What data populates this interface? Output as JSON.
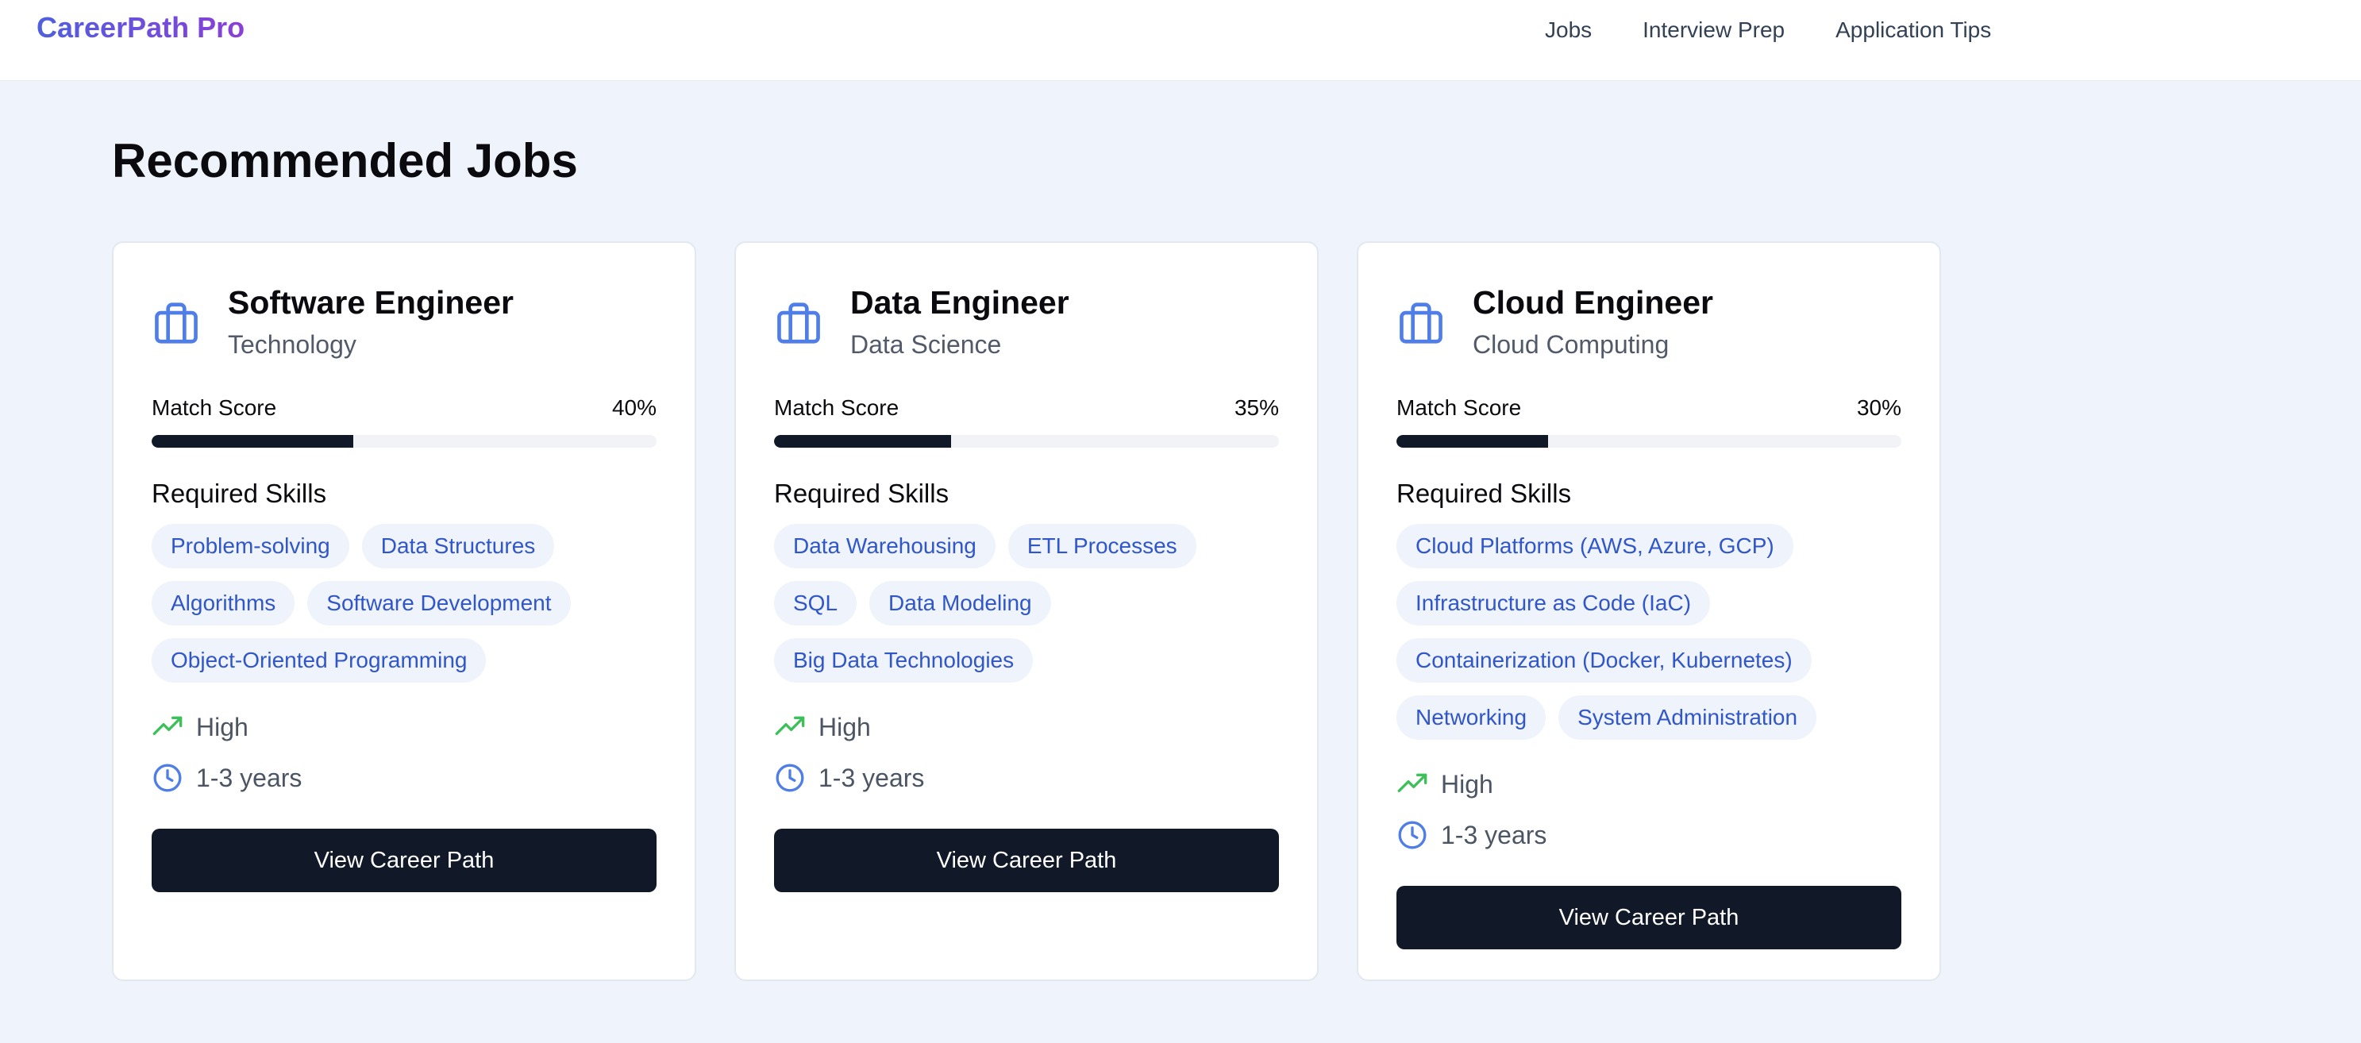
{
  "brand": {
    "name": "CareerPath Pro",
    "gradient": [
      "#4f5fe0",
      "#8a3fd6"
    ]
  },
  "nav": {
    "links": [
      "Jobs",
      "Interview Prep",
      "Application Tips"
    ]
  },
  "page": {
    "title": "Recommended Jobs"
  },
  "colors": {
    "accent_blue": "#4f7fe6",
    "trend_green": "#3fbf5a",
    "button_dark": "#111827",
    "chip_bg": "#eef3fc",
    "chip_text": "#3156c7"
  },
  "cards": [
    {
      "icon": "briefcase-icon",
      "title": "Software Engineer",
      "category": "Technology",
      "match_label": "Match Score",
      "match_value": "40%",
      "match_fraction": 0.4,
      "skills_label": "Required Skills",
      "skills": [
        "Problem-solving",
        "Data Structures",
        "Algorithms",
        "Software Development",
        "Object-Oriented Programming"
      ],
      "demand_icon": "trending-up-icon",
      "demand": "High",
      "experience_icon": "clock-icon",
      "experience": "1-3 years",
      "button": "View Career Path"
    },
    {
      "icon": "briefcase-icon",
      "title": "Data Engineer",
      "category": "Data Science",
      "match_label": "Match Score",
      "match_value": "35%",
      "match_fraction": 0.35,
      "skills_label": "Required Skills",
      "skills": [
        "Data Warehousing",
        "ETL Processes",
        "SQL",
        "Data Modeling",
        "Big Data Technologies"
      ],
      "demand_icon": "trending-up-icon",
      "demand": "High",
      "experience_icon": "clock-icon",
      "experience": "1-3 years",
      "button": "View Career Path"
    },
    {
      "icon": "briefcase-icon",
      "title": "Cloud Engineer",
      "category": "Cloud Computing",
      "match_label": "Match Score",
      "match_value": "30%",
      "match_fraction": 0.3,
      "skills_label": "Required Skills",
      "skills": [
        "Cloud Platforms (AWS, Azure, GCP)",
        "Infrastructure as Code (IaC)",
        "Containerization (Docker, Kubernetes)",
        "Networking",
        "System Administration"
      ],
      "demand_icon": "trending-up-icon",
      "demand": "High",
      "experience_icon": "clock-icon",
      "experience": "1-3 years",
      "button": "View Career Path"
    }
  ]
}
